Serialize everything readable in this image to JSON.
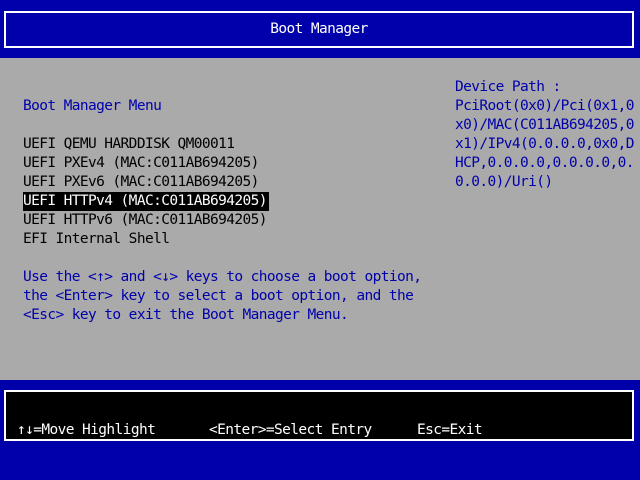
{
  "header": {
    "title": "Boot Manager"
  },
  "menu": {
    "title": "Boot Manager Menu",
    "items": [
      {
        "label": "UEFI QEMU HARDDISK QM00011"
      },
      {
        "label": "UEFI PXEv4 (MAC:C011AB694205)"
      },
      {
        "label": "UEFI PXEv6 (MAC:C011AB694205)"
      },
      {
        "label": "UEFI HTTPv4 (MAC:C011AB694205)"
      },
      {
        "label": "UEFI HTTPv6 (MAC:C011AB694205)"
      },
      {
        "label": "EFI Internal Shell"
      }
    ],
    "selected_index": 3
  },
  "help": {
    "lines": [
      "Use the <↑> and <↓> keys to choose a boot option,",
      "the <Enter> key to select a boot option, and the",
      "<Esc> key to exit the Boot Manager Menu."
    ]
  },
  "device_path": {
    "label": "Device Path :",
    "lines": [
      "PciRoot(0x0)/Pci(0x1,0",
      "x0)/MAC(C011AB694205,0",
      "x1)/IPv4(0.0.0.0,0x0,D",
      "HCP,0.0.0.0,0.0.0.0,0.",
      "0.0.0)/Uri()"
    ]
  },
  "footer": {
    "move": "↑↓=Move Highlight",
    "select": "<Enter>=Select Entry",
    "exit": "Esc=Exit"
  },
  "colors": {
    "background": "#0000aa",
    "panel": "#aaaaaa",
    "selected_bg": "#000000",
    "selected_fg": "#ffffff"
  }
}
